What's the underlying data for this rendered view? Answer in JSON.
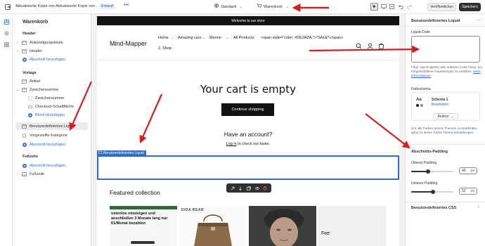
{
  "topbar": {
    "title": "Aktualisierte Kopie von Aktualisierte Kopie von…",
    "badge": "Entwurf",
    "more": "•••",
    "theme_select": "Standard",
    "page_select": "Warenkorb",
    "view_label": "Veröffentlichen",
    "save_label": "Speichern"
  },
  "sidebar": {
    "title": "Warenkorb",
    "sections": [
      {
        "name": "Header"
      },
      {
        "name": "Vorlage"
      },
      {
        "name": "Fußzeile"
      }
    ],
    "items": [
      {
        "label": "Ankündigungsleiste"
      },
      {
        "label": "Header"
      },
      {
        "label": "Abschnitt hinzufügen"
      },
      {
        "label": "Artikel"
      },
      {
        "label": "Zwischensumme"
      },
      {
        "label": "Zwischensumme"
      },
      {
        "label": "Checkout-Schaltfläche"
      },
      {
        "label": "Block hinzufügen"
      },
      {
        "label": "Benutzerdefiniertes Liquid"
      },
      {
        "label": "Vorgestellte Kategorie"
      },
      {
        "label": "Abschnitt hinzufügen"
      },
      {
        "label": "Abschnitt hinzufügen"
      },
      {
        "label": "Fußzeile"
      }
    ]
  },
  "preview": {
    "announcement": "Welcome to our store",
    "logo": "Mind-Mapper",
    "nav": [
      "Home",
      "Amazing cars",
      "Merino",
      "All Products",
      "<span style=\"color: #DE2A2A;\">*SALE*</span>"
    ],
    "nav_wrap": "2. Shop",
    "cart_heading": "Your cart is empty",
    "continue_button": "Continue shopping",
    "account_heading": "Have an account?",
    "login_link": "Log in",
    "login_rest": " to check out faster.",
    "liquid_label": "Benutzerdefiniertes Liquid",
    "featured_heading": "Featured collection",
    "product1_text": "ostenlos einsteigen und anschließen 3 Monate lang nur €1/Monat bezahlen",
    "product2_brand": "DIDA BEAR",
    "product4_text": "Fee"
  },
  "panel": {
    "title": "Benutzerdefiniertes Liquid",
    "liquid_code_label": "Liquid-Code",
    "help_text": "Füge App-Snippets oder anderen Code hinzu, um fortgeschrittene Anpassungen zu erstellen.",
    "help_link": "Mehr Informationen",
    "color_scheme_label": "Farbschema",
    "scheme_name": "Schema 1",
    "scheme_edit": "Bearbeiten",
    "scheme_change": "Ändern",
    "theme_note": "Um alle Farben deines Themes zu bearbeiten, gehe zu deiner Farbe",
    "theme_note_link": "Theme-Einstellungen.",
    "padding_heading": "Abschnitts-Padding",
    "top_padding_label": "Oberes Padding",
    "top_padding_value": "40",
    "bottom_padding_label": "Unteres Padding",
    "bottom_padding_value": "52",
    "padding_unit": "px",
    "padding_max": 100,
    "css_heading": "Benutzerdefiniertes CSS"
  },
  "colors": {
    "accent": "#2c6ecb",
    "arrow": "#d41f1f",
    "dark": "#121212"
  }
}
